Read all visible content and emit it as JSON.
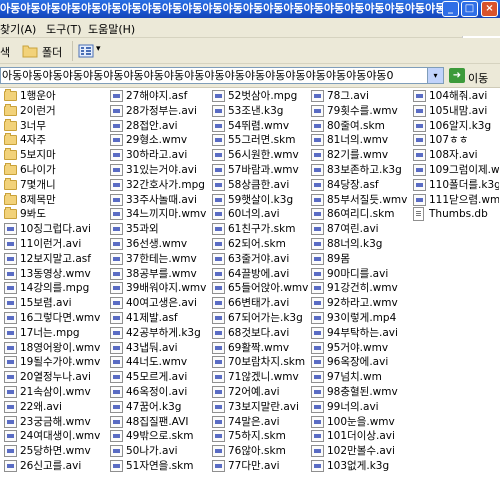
{
  "window": {
    "title": "아동야동야동야동야동야동야동야동야동야동야동야동야동야동야동야동야동야동야동야동야동야동",
    "minimize_label": "_",
    "maximize_label": "□",
    "close_label": "×"
  },
  "menu": {
    "file": "찾기(A)",
    "tools": "도구(T)",
    "help": "도움말(H)"
  },
  "toolbar": {
    "search_label": "색",
    "folders_label": "폴더",
    "view_dropdown": "▾"
  },
  "address": {
    "value": "아동야동야동야동야동야동야동야동야동야동야동야동야동야동야동야동야동야동야동0",
    "dropdown": "▾",
    "go_label": "이동",
    "go_arrow": "➜"
  },
  "files": {
    "col1": [
      {
        "name": "1행운아",
        "type": "folder"
      },
      {
        "name": "2이런거",
        "type": "folder"
      },
      {
        "name": "3너무",
        "type": "folder"
      },
      {
        "name": "4자주",
        "type": "folder"
      },
      {
        "name": "5보지마",
        "type": "folder"
      },
      {
        "name": "6나이가",
        "type": "folder"
      },
      {
        "name": "7몇개니",
        "type": "folder"
      },
      {
        "name": "8제목만",
        "type": "folder"
      },
      {
        "name": "9봐도",
        "type": "folder"
      },
      {
        "name": "10징그럽다.avi",
        "type": "video"
      },
      {
        "name": "11이런거.avi",
        "type": "video"
      },
      {
        "name": "12보지말고.asf",
        "type": "video"
      },
      {
        "name": "13동영상.wmv",
        "type": "video"
      },
      {
        "name": "14강의를.mpg",
        "type": "video"
      },
      {
        "name": "15보렴.avi",
        "type": "video"
      },
      {
        "name": "16그렇다면.wmv",
        "type": "video"
      },
      {
        "name": "17너는.mpg",
        "type": "video"
      },
      {
        "name": "18영어왕이.wmv",
        "type": "video"
      },
      {
        "name": "19될수가야.wmv",
        "type": "video"
      },
      {
        "name": "20열정누나.avi",
        "type": "video"
      },
      {
        "name": "21속삼이.wmv",
        "type": "video"
      },
      {
        "name": "22왜.avi",
        "type": "video"
      },
      {
        "name": "23궁금해.wmv",
        "type": "video"
      },
      {
        "name": "24여대생이.wmv",
        "type": "video"
      },
      {
        "name": "25당하면.wmv",
        "type": "video"
      },
      {
        "name": "26신고를.avi",
        "type": "video"
      }
    ],
    "col2": [
      {
        "name": "27해야지.asf",
        "type": "video"
      },
      {
        "name": "28가정부는.avi",
        "type": "video"
      },
      {
        "name": "28접안.avi",
        "type": "video"
      },
      {
        "name": "29형소.wmv",
        "type": "video"
      },
      {
        "name": "30하라고.avi",
        "type": "video"
      },
      {
        "name": "31있는거야.avi",
        "type": "video"
      },
      {
        "name": "32간호사가.mpg",
        "type": "video"
      },
      {
        "name": "33주사놀때.avi",
        "type": "video"
      },
      {
        "name": "34느끼지마.wmv",
        "type": "video"
      },
      {
        "name": "35과외",
        "type": "video"
      },
      {
        "name": "36선생.wmv",
        "type": "video"
      },
      {
        "name": "37한테는.wmv",
        "type": "video"
      },
      {
        "name": "38공부를.wmv",
        "type": "video"
      },
      {
        "name": "39배워야지.wmv",
        "type": "video"
      },
      {
        "name": "40여고생은.avi",
        "type": "video"
      },
      {
        "name": "41제발.asf",
        "type": "video"
      },
      {
        "name": "42공부하게.k3g",
        "type": "video"
      },
      {
        "name": "43냅둬.avi",
        "type": "video"
      },
      {
        "name": "44너도.wmv",
        "type": "video"
      },
      {
        "name": "45모르게.avi",
        "type": "video"
      },
      {
        "name": "46옥정이.avi",
        "type": "video"
      },
      {
        "name": "47꿈어.k3g",
        "type": "video"
      },
      {
        "name": "48집질팬.AVI",
        "type": "video"
      },
      {
        "name": "49밖으로.skm",
        "type": "video"
      },
      {
        "name": "50나가.avi",
        "type": "video"
      },
      {
        "name": "51자연을.skm",
        "type": "video"
      }
    ],
    "col3": [
      {
        "name": "52벗삼아.mpg",
        "type": "video"
      },
      {
        "name": "53조낸.k3g",
        "type": "video"
      },
      {
        "name": "54뛰렴.wmv",
        "type": "video"
      },
      {
        "name": "55그러면.skm",
        "type": "video"
      },
      {
        "name": "56시원한.wmv",
        "type": "video"
      },
      {
        "name": "57바람과.wmv",
        "type": "video"
      },
      {
        "name": "58상큼한.avi",
        "type": "video"
      },
      {
        "name": "59햇살이.k3g",
        "type": "video"
      },
      {
        "name": "60너의.avi",
        "type": "video"
      },
      {
        "name": "61친구가.skm",
        "type": "video"
      },
      {
        "name": "62되어.skm",
        "type": "video"
      },
      {
        "name": "63줄거야.avi",
        "type": "video"
      },
      {
        "name": "64끌방에.avi",
        "type": "video"
      },
      {
        "name": "65들어앉아.wmv",
        "type": "video"
      },
      {
        "name": "66변태가.avi",
        "type": "video"
      },
      {
        "name": "67되어가는.k3g",
        "type": "video"
      },
      {
        "name": "68것보다.avi",
        "type": "video"
      },
      {
        "name": "69활짝.wmv",
        "type": "video"
      },
      {
        "name": "70보람차지.skm",
        "type": "video"
      },
      {
        "name": "71않겠니.wmv",
        "type": "video"
      },
      {
        "name": "72어예.avi",
        "type": "video"
      },
      {
        "name": "73보지말란.avi",
        "type": "video"
      },
      {
        "name": "74말은.avi",
        "type": "video"
      },
      {
        "name": "75하지.skm",
        "type": "video"
      },
      {
        "name": "76않아.skm",
        "type": "video"
      },
      {
        "name": "77다만.avi",
        "type": "video"
      }
    ],
    "col4": [
      {
        "name": "78그.avi",
        "type": "video"
      },
      {
        "name": "79횟수를.wmv",
        "type": "video"
      },
      {
        "name": "80줄여.skm",
        "type": "video"
      },
      {
        "name": "81너의.wmv",
        "type": "video"
      },
      {
        "name": "82기를.wmv",
        "type": "video"
      },
      {
        "name": "83보존하고.k3g",
        "type": "video"
      },
      {
        "name": "84당장.asf",
        "type": "video"
      },
      {
        "name": "85부서질듯.wmv",
        "type": "video"
      },
      {
        "name": "86여리디.skm",
        "type": "video"
      },
      {
        "name": "87여린.avi",
        "type": "video"
      },
      {
        "name": "88너의.k3g",
        "type": "video"
      },
      {
        "name": "89몸",
        "type": "video"
      },
      {
        "name": "90마디를.avi",
        "type": "video"
      },
      {
        "name": "91강건히.wmv",
        "type": "video"
      },
      {
        "name": "92하라고.wmv",
        "type": "video"
      },
      {
        "name": "93이렇게.mp4",
        "type": "video"
      },
      {
        "name": "94부탁하는.avi",
        "type": "video"
      },
      {
        "name": "95거야.wmv",
        "type": "video"
      },
      {
        "name": "96옥장에.avi",
        "type": "video"
      },
      {
        "name": "97넘치.wm",
        "type": "video"
      },
      {
        "name": "98충혈된.wmv",
        "type": "video"
      },
      {
        "name": "99너의.avi",
        "type": "video"
      },
      {
        "name": "100눈을.wmv",
        "type": "video"
      },
      {
        "name": "101더이상.avi",
        "type": "video"
      },
      {
        "name": "102만볼수.avi",
        "type": "video"
      },
      {
        "name": "103없게.k3g",
        "type": "video"
      }
    ],
    "col5": [
      {
        "name": "104해줘.avi",
        "type": "video"
      },
      {
        "name": "105내맘.avi",
        "type": "video"
      },
      {
        "name": "106알지.k3g",
        "type": "video"
      },
      {
        "name": "107ㅎㅎ",
        "type": "video"
      },
      {
        "name": "108자.avi",
        "type": "video"
      },
      {
        "name": "109그럼이제.wmv",
        "type": "video"
      },
      {
        "name": "110폴더를.k3g",
        "type": "video"
      },
      {
        "name": "111닫으렴.wmv",
        "type": "video"
      },
      {
        "name": "Thumbs.db",
        "type": "doc"
      }
    ]
  }
}
